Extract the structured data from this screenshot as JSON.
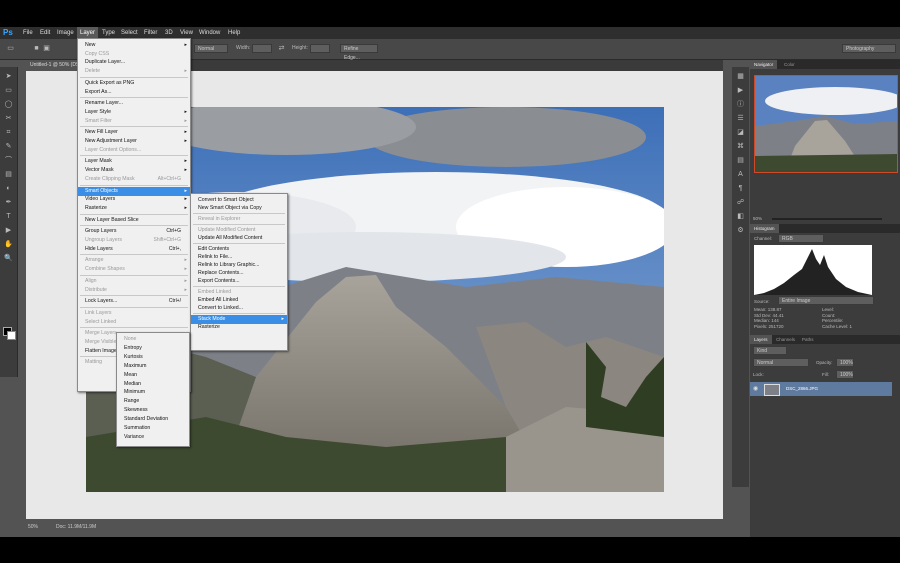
{
  "menubar": [
    "File",
    "Edit",
    "Image",
    "Layer",
    "Type",
    "Select",
    "Filter",
    "3D",
    "View",
    "Window",
    "Help"
  ],
  "active_menu": "Layer",
  "options": {
    "mode": "Normal",
    "width_label": "Width:",
    "height_label": "Height:",
    "refine": "Refine Edge...",
    "workspace": "Photography"
  },
  "document_tab": "Untitled-1 @ 50% (DS...",
  "status": {
    "zoom": "50%",
    "doc": "Doc: 11.9M/11.9M"
  },
  "layer_menu": [
    {
      "label": "New",
      "arrow": true
    },
    {
      "label": "Copy CSS",
      "dis": true
    },
    {
      "label": "Duplicate Layer..."
    },
    {
      "label": "Delete",
      "arrow": true,
      "dis": true
    },
    {
      "sep": true
    },
    {
      "label": "Quick Export as PNG"
    },
    {
      "label": "Export As..."
    },
    {
      "sep": true
    },
    {
      "label": "Rename Layer..."
    },
    {
      "label": "Layer Style",
      "arrow": true
    },
    {
      "label": "Smart Filter",
      "arrow": true,
      "dis": true
    },
    {
      "sep": true
    },
    {
      "label": "New Fill Layer",
      "arrow": true
    },
    {
      "label": "New Adjustment Layer",
      "arrow": true
    },
    {
      "label": "Layer Content Options...",
      "dis": true
    },
    {
      "sep": true
    },
    {
      "label": "Layer Mask",
      "arrow": true
    },
    {
      "label": "Vector Mask",
      "arrow": true
    },
    {
      "label": "Create Clipping Mask",
      "sc": "Alt+Ctrl+G",
      "dis": true
    },
    {
      "sep": true
    },
    {
      "label": "Smart Objects",
      "arrow": true,
      "hl": true
    },
    {
      "label": "Video Layers",
      "arrow": true
    },
    {
      "label": "Rasterize",
      "arrow": true
    },
    {
      "sep": true
    },
    {
      "label": "New Layer Based Slice"
    },
    {
      "sep": true
    },
    {
      "label": "Group Layers",
      "sc": "Ctrl+G"
    },
    {
      "label": "Ungroup Layers",
      "sc": "Shift+Ctrl+G",
      "dis": true
    },
    {
      "label": "Hide Layers",
      "sc": "Ctrl+,"
    },
    {
      "sep": true
    },
    {
      "label": "Arrange",
      "arrow": true,
      "dis": true
    },
    {
      "label": "Combine Shapes",
      "arrow": true,
      "dis": true
    },
    {
      "sep": true
    },
    {
      "label": "Align",
      "arrow": true,
      "dis": true
    },
    {
      "label": "Distribute",
      "arrow": true,
      "dis": true
    },
    {
      "sep": true
    },
    {
      "label": "Lock Layers...",
      "sc": "Ctrl+/"
    },
    {
      "sep": true
    },
    {
      "label": "Link Layers",
      "dis": true
    },
    {
      "label": "Select Linked",
      "dis": true
    },
    {
      "sep": true
    },
    {
      "label": "Merge Layers",
      "dis": true
    },
    {
      "label": "Merge Visible",
      "dis": true
    },
    {
      "label": "Flatten Image"
    },
    {
      "sep": true
    },
    {
      "label": "Matting",
      "arrow": true,
      "dis": true
    }
  ],
  "smart_menu": [
    {
      "label": "Convert to Smart Object"
    },
    {
      "label": "New Smart Object via Copy"
    },
    {
      "sep": true
    },
    {
      "label": "Reveal in Explorer",
      "dis": true
    },
    {
      "sep": true
    },
    {
      "label": "Update Modified Content",
      "dis": true
    },
    {
      "label": "Update All Modified Content"
    },
    {
      "sep": true
    },
    {
      "label": "Edit Contents"
    },
    {
      "label": "Relink to File..."
    },
    {
      "label": "Relink to Library Graphic..."
    },
    {
      "label": "Replace Contents..."
    },
    {
      "label": "Export Contents..."
    },
    {
      "sep": true
    },
    {
      "label": "Embed Linked",
      "dis": true
    },
    {
      "label": "Embed All Linked"
    },
    {
      "label": "Convert to Linked..."
    },
    {
      "sep": true
    },
    {
      "label": "Stack Mode",
      "arrow": true,
      "hl": true
    },
    {
      "label": "Rasterize"
    }
  ],
  "stack_menu": [
    {
      "label": "None",
      "dis": true
    },
    {
      "label": "Entropy"
    },
    {
      "label": "Kurtosis"
    },
    {
      "label": "Maximum"
    },
    {
      "label": "Mean"
    },
    {
      "label": "Median"
    },
    {
      "label": "Minimum"
    },
    {
      "label": "Range"
    },
    {
      "label": "Skewness"
    },
    {
      "label": "Standard Deviation"
    },
    {
      "label": "Summation"
    },
    {
      "label": "Variance"
    }
  ],
  "navigator": {
    "tab1": "Navigator",
    "tab2": "Color",
    "zoom": "50%"
  },
  "histogram": {
    "tab": "Histogram",
    "channel_label": "Channel:",
    "channel": "RGB",
    "source_label": "Source:",
    "source": "Entire Image",
    "stats_left": [
      "Mean: 138.87",
      "Std Dev: 44.41",
      "Median: 144",
      "Pixels: 251720"
    ],
    "stats_right": [
      "Level:",
      "Count:",
      "Percentile:",
      "Cache Level: 1"
    ]
  },
  "layers": {
    "tabs": [
      "Layers",
      "Channels",
      "Paths"
    ],
    "kind": "Kind",
    "blend": "Normal",
    "opacity_label": "Opacity:",
    "opacity": "100%",
    "lock_label": "Lock:",
    "fill_label": "Fill:",
    "fill": "100%",
    "layer_name": "DSC_2866.JPG"
  },
  "colors": {
    "highlight": "#3a8ee6",
    "selected_layer": "#5e7a9e"
  }
}
